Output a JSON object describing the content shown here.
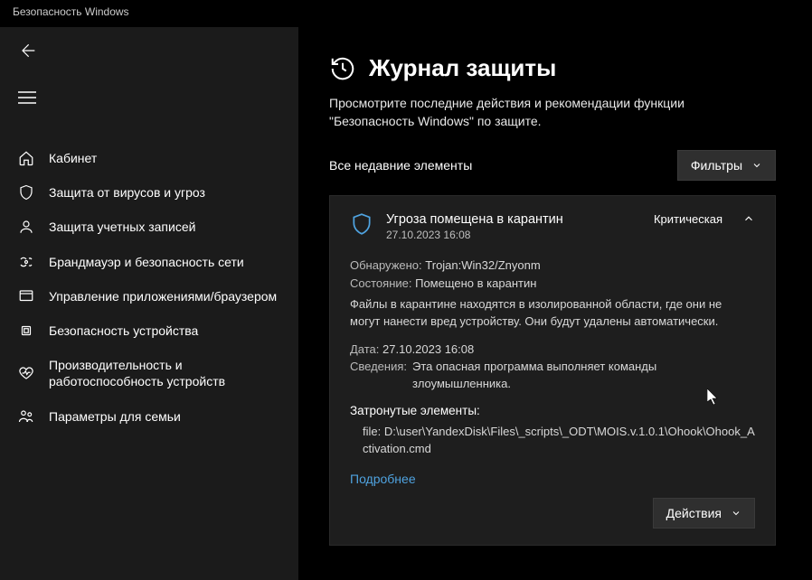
{
  "window": {
    "title": "Безопасность Windows"
  },
  "sidebar": {
    "items": [
      {
        "label": "Кабинет"
      },
      {
        "label": "Защита от вирусов и угроз"
      },
      {
        "label": "Защита учетных записей"
      },
      {
        "label": "Брандмауэр и безопасность сети"
      },
      {
        "label": "Управление приложениями/браузером"
      },
      {
        "label": "Безопасность устройства"
      },
      {
        "label": "Производительность и работоспособность устройств"
      },
      {
        "label": "Параметры для семьи"
      }
    ]
  },
  "page": {
    "title": "Журнал защиты",
    "subtitle": "Просмотрите последние действия и рекомендации функции \"Безопасность Windows\" по защите."
  },
  "toolbar": {
    "recent_label": "Все недавние элементы",
    "filters_label": "Фильтры"
  },
  "threat": {
    "title": "Угроза помещена в карантин",
    "timestamp": "27.10.2023 16:08",
    "severity": "Критическая",
    "detected_label": "Обнаружено:",
    "detected_value": "Trojan:Win32/Znyonm",
    "status_label": "Состояние:",
    "status_value": "Помещено в карантин",
    "description": "Файлы в карантине находятся в изолированной области, где они не могут нанести вред устройству. Они будут удалены автоматически.",
    "date_label": "Дата:",
    "date_value": "27.10.2023 16:08",
    "details_label": "Сведения:",
    "details_value": "Эта опасная программа выполняет команды злоумышленника.",
    "affected_heading": "Затронутые элементы:",
    "file_prefix": "file:",
    "file_path": "D:\\user\\YandexDisk\\Files\\_scripts\\_ODT\\MOIS.v.1.0.1\\Ohook\\Ohook_Activation.cmd",
    "learn_more": "Подробнее",
    "actions_label": "Действия"
  }
}
